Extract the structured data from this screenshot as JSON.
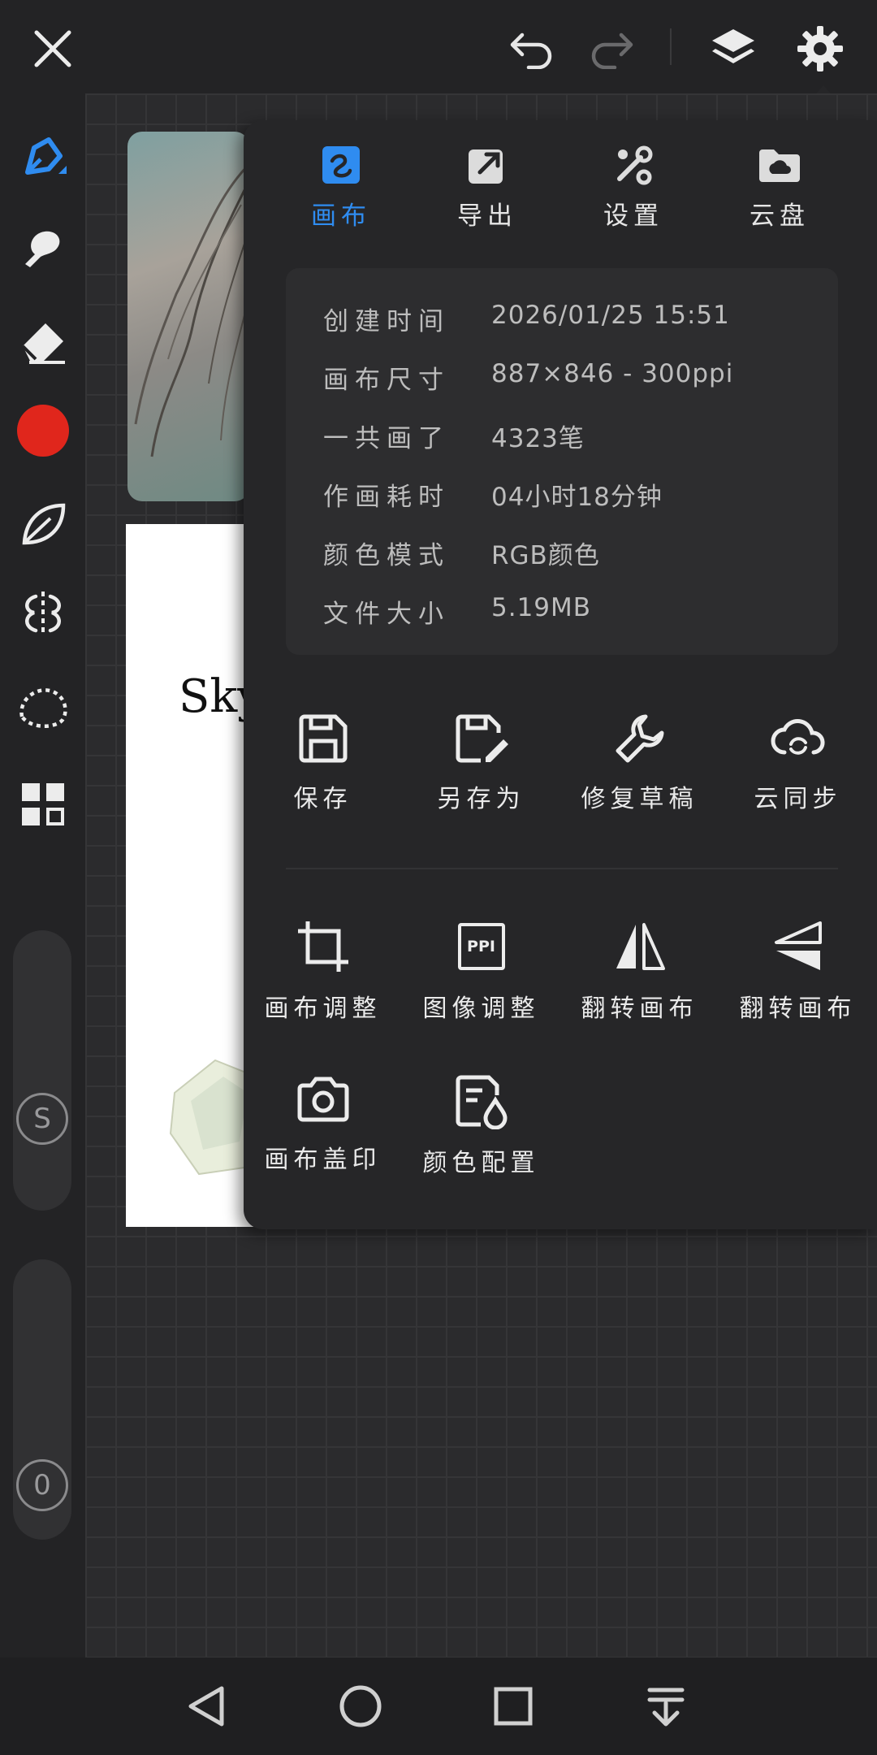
{
  "top_bar": {
    "icons": [
      "close-icon",
      "undo-icon",
      "redo-icon",
      "layers-icon",
      "gear-icon"
    ]
  },
  "sidebar": {
    "tools": [
      "pen-icon",
      "smudge-icon",
      "eraser-icon",
      "color-swatch",
      "leaf-icon",
      "symmetry-icon",
      "lasso-icon",
      "grid-apps-icon"
    ],
    "brush_size_label": "S",
    "opacity_label": "0",
    "color": "#e0261c"
  },
  "canvas": {
    "thumbnail_text": "Sky"
  },
  "panel": {
    "tabs": [
      {
        "label": "画布",
        "icon": "canvas-icon",
        "active": true
      },
      {
        "label": "导出",
        "icon": "export-icon",
        "active": false
      },
      {
        "label": "设置",
        "icon": "tools-icon",
        "active": false
      },
      {
        "label": "云盘",
        "icon": "cloud-folder-icon",
        "active": false
      }
    ],
    "info": [
      {
        "key": "创建时间",
        "value": "2026/01/25 15:51"
      },
      {
        "key": "画布尺寸",
        "value": "887×846 - 300ppi"
      },
      {
        "key": "一共画了",
        "value": "4323笔"
      },
      {
        "key": "作画耗时",
        "value": "04小时18分钟"
      },
      {
        "key": "颜色模式",
        "value": "RGB颜色"
      },
      {
        "key": "文件大小",
        "value": "5.19MB"
      }
    ],
    "actions_row1": [
      {
        "label": "保存",
        "icon": "save-icon"
      },
      {
        "label": "另存为",
        "icon": "save-as-icon"
      },
      {
        "label": "修复草稿",
        "icon": "wrench-icon"
      },
      {
        "label": "云同步",
        "icon": "cloud-sync-icon"
      }
    ],
    "actions_row2": [
      {
        "label": "画布调整",
        "icon": "crop-icon"
      },
      {
        "label": "图像调整",
        "icon": "ppi-icon",
        "badge": "PPI"
      },
      {
        "label": "翻转画布",
        "icon": "flip-horizontal-icon"
      },
      {
        "label": "翻转画布",
        "icon": "flip-vertical-icon"
      }
    ],
    "actions_row3": [
      {
        "label": "画布盖印",
        "icon": "camera-icon"
      },
      {
        "label": "颜色配置",
        "icon": "color-profile-icon"
      }
    ],
    "accent": "#2f8cf0"
  },
  "nav_bar": {
    "icons": [
      "back-icon",
      "home-icon",
      "recents-icon",
      "notification-pull-icon"
    ]
  }
}
